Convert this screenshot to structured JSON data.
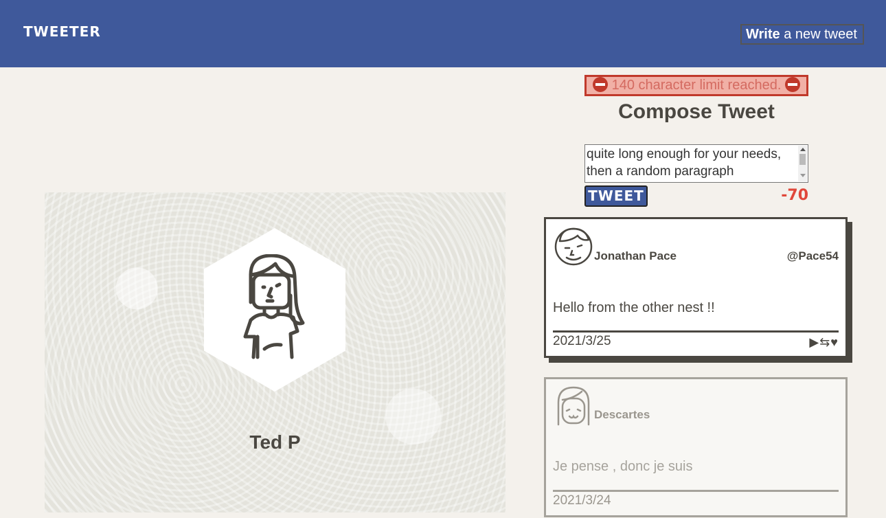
{
  "nav": {
    "brand": "TWEETER",
    "write_bold": "Write",
    "write_rest": " a new tweet"
  },
  "profile": {
    "name": "Ted P"
  },
  "compose": {
    "error": "140 character limit reached.",
    "title": "Compose Tweet",
    "input_value": "quite long enough for your needs, then a random paragraph",
    "button": "TWEET",
    "counter": "-70"
  },
  "tweets": [
    {
      "author": "Jonathan Pace",
      "handle": "@Pace54",
      "content": "Hello from the other nest !!",
      "date": "2021/3/25",
      "actions": "▶⇆♥"
    },
    {
      "author": "Descartes",
      "content": "Je pense , donc je suis",
      "date": "2021/3/24"
    }
  ],
  "colors": {
    "nav": "#3f599b",
    "background": "#f4f1ec",
    "text": "#4a4741",
    "error": "#c0392b",
    "counter": "#e0473a"
  },
  "icons": {
    "error": "no-entry-icon",
    "avatar_1": "smiling-man-avatar-icon",
    "avatar_2": "smiling-girl-avatar-icon",
    "profile": "woman-avatar-icon"
  }
}
